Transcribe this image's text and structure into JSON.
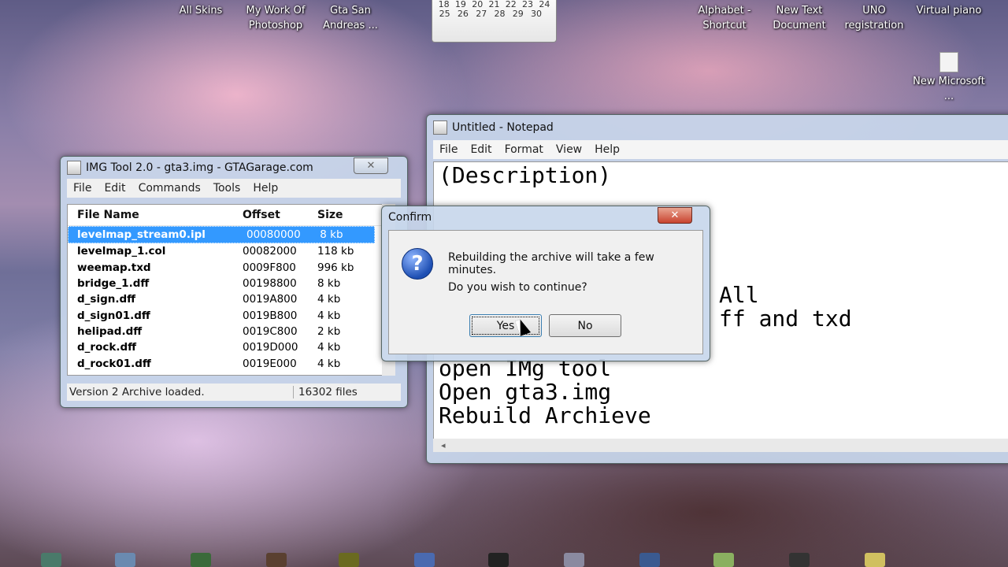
{
  "desktop": {
    "icons": [
      {
        "label": "All Skins"
      },
      {
        "label": "My Work Of Photoshop"
      },
      {
        "label": "Gta San Andreas ..."
      },
      {
        "label": "Alphabet - Shortcut"
      },
      {
        "label": "New Text Document"
      },
      {
        "label": "UNO registration"
      },
      {
        "label": "Virtual piano"
      },
      {
        "label": "New Microsoft ..."
      }
    ],
    "calendar": {
      "row1": [
        "18",
        "19",
        "20",
        "21",
        "22",
        "23",
        "24"
      ],
      "row2": [
        "25",
        "26",
        "27",
        "28",
        "29",
        "30",
        ""
      ]
    }
  },
  "imgtool": {
    "title": "IMG Tool 2.0 - gta3.img - GTAGarage.com",
    "menu": [
      "File",
      "Edit",
      "Commands",
      "Tools",
      "Help"
    ],
    "columns": {
      "name": "File Name",
      "offset": "Offset",
      "size": "Size"
    },
    "rows": [
      {
        "name": "levelmap_stream0.ipl",
        "offset": "00080000",
        "size": "8 kb"
      },
      {
        "name": "levelmap_1.col",
        "offset": "00082000",
        "size": "118 kb"
      },
      {
        "name": "weemap.txd",
        "offset": "0009F800",
        "size": "996 kb"
      },
      {
        "name": "bridge_1.dff",
        "offset": "00198800",
        "size": "8 kb"
      },
      {
        "name": "d_sign.dff",
        "offset": "0019A800",
        "size": "4 kb"
      },
      {
        "name": "d_sign01.dff",
        "offset": "0019B800",
        "size": "4 kb"
      },
      {
        "name": "helipad.dff",
        "offset": "0019C800",
        "size": "2 kb"
      },
      {
        "name": "d_rock.dff",
        "offset": "0019D000",
        "size": "4 kb"
      },
      {
        "name": "d_rock01.dff",
        "offset": "0019E000",
        "size": "4 kb"
      }
    ],
    "status": "Version 2 Archive loaded.",
    "file_count": "16302 files",
    "close": "✕"
  },
  "notepad": {
    "title": "Untitled - Notepad",
    "menu": [
      "File",
      "Edit",
      "Format",
      "View",
      "Help"
    ],
    "lines": {
      "l1": "(Description)",
      "l2": "All",
      "l3": "ff and txd",
      "l4": "open IMg tool",
      "l5": "Open gta3.img",
      "l6": "Rebuild Archieve"
    }
  },
  "confirm": {
    "title": "Confirm",
    "message": "Rebuilding the archive will take a few minutes.",
    "question": "Do you wish to continue?",
    "yes": "Yes",
    "no": "No",
    "close": "✕"
  },
  "colors": {
    "selection": "#3399ff",
    "close_red": "#c8432f"
  }
}
